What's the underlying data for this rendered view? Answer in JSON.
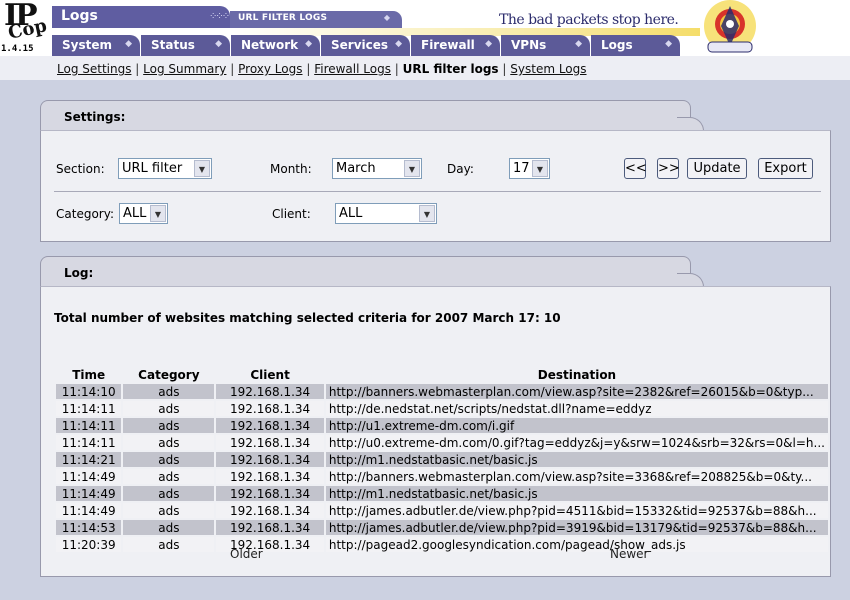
{
  "app": {
    "logo": "IPCop",
    "version": "1.4.15",
    "section_title": "Logs",
    "sub_tab": "URL FILTER LOGS",
    "slogan": "The bad packets stop here."
  },
  "main_tabs": [
    {
      "label": "System"
    },
    {
      "label": "Status"
    },
    {
      "label": "Network"
    },
    {
      "label": "Services"
    },
    {
      "label": "Firewall"
    },
    {
      "label": "VPNs"
    },
    {
      "label": "Logs"
    }
  ],
  "subnav": {
    "items": [
      "Log Settings",
      "Log Summary",
      "Proxy Logs",
      "Firewall Logs",
      "URL filter logs",
      "System Logs"
    ],
    "separator": "|"
  },
  "settings": {
    "title": "Settings:",
    "section_label": "Section:",
    "section_value": "URL filter",
    "month_label": "Month:",
    "month_value": "March",
    "day_label": "Day:",
    "day_value": "17",
    "prev_label": "<<",
    "next_label": ">>",
    "update_label": "Update",
    "export_label": "Export",
    "category_label": "Category:",
    "category_value": "ALL",
    "client_label": "Client:",
    "client_value": "ALL"
  },
  "log": {
    "title": "Log:",
    "summary": "Total number of websites matching selected criteria for 2007 March 17: 10",
    "columns": [
      "Time",
      "Category",
      "Client",
      "Destination"
    ],
    "rows": [
      [
        "11:14:10",
        "ads",
        "192.168.1.34",
        "http://banners.webmasterplan.com/view.asp?site=2382&ref=26015&b=0&typ..."
      ],
      [
        "11:14:11",
        "ads",
        "192.168.1.34",
        "http://de.nedstat.net/scripts/nedstat.dll?name=eddyz"
      ],
      [
        "11:14:11",
        "ads",
        "192.168.1.34",
        "http://u1.extreme-dm.com/i.gif"
      ],
      [
        "11:14:11",
        "ads",
        "192.168.1.34",
        "http://u0.extreme-dm.com/0.gif?tag=eddyz&j=y&srw=1024&srb=32&rs=0&l=h..."
      ],
      [
        "11:14:21",
        "ads",
        "192.168.1.34",
        "http://m1.nedstatbasic.net/basic.js"
      ],
      [
        "11:14:49",
        "ads",
        "192.168.1.34",
        "http://banners.webmasterplan.com/view.asp?site=3368&ref=208825&b=0&ty..."
      ],
      [
        "11:14:49",
        "ads",
        "192.168.1.34",
        "http://m1.nedstatbasic.net/basic.js"
      ],
      [
        "11:14:49",
        "ads",
        "192.168.1.34",
        "http://james.adbutler.de/view.php?pid=4511&bid=15332&tid=92537&b=88&h..."
      ],
      [
        "11:14:53",
        "ads",
        "192.168.1.34",
        "http://james.adbutler.de/view.php?pid=3919&bid=13179&tid=92537&b=88&h..."
      ],
      [
        "11:20:39",
        "ads",
        "192.168.1.34",
        "http://pagead2.googlesyndication.com/pagead/show_ads.js"
      ]
    ],
    "older_label": "Older",
    "newer_label": "Newer"
  },
  "colors": {
    "background": "#ccd1e1",
    "tab_purple": "#5c5a98",
    "row_dark": "#c2c3cc",
    "row_light": "#f2f2f5"
  }
}
